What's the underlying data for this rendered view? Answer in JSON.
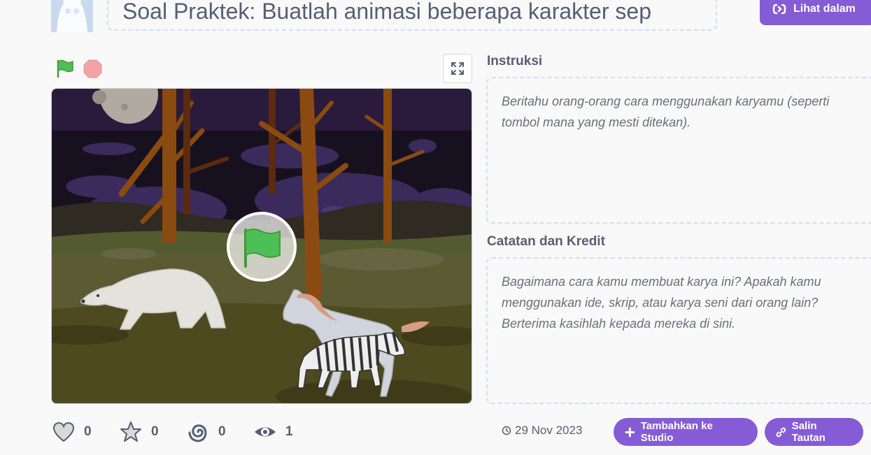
{
  "header": {
    "project_title": "Soal Praktek: Buatlah animasi beberapa karakter sep",
    "see_inside_label": "Lihat dalam"
  },
  "sidebar": {
    "instructions_label": "Instruksi",
    "instructions_placeholder": "Beritahu orang-orang cara menggunakan karyamu (seperti tombol mana yang mesti ditekan).",
    "notes_label": "Catatan dan Kredit",
    "notes_placeholder": "Bagaimana cara kamu membuat karya ini? Apakah kamu menggunakan ide, skrip, atau karya seni dari orang lain? Berterima kasihlah kepada mereka di sini."
  },
  "stats": {
    "loves": "0",
    "favorites": "0",
    "remixes": "0",
    "views": "1"
  },
  "footer": {
    "date": "29 Nov 2023",
    "add_to_studio_label": "Tambahkan ke Studio",
    "copy_link_label": "Salin Tautan"
  },
  "colors": {
    "accent": "#855cd6",
    "text": "#575e75",
    "flag_green": "#4cbf56",
    "stop_red": "#f2a3a3"
  },
  "icons": [
    "remix-icon",
    "green-flag-icon",
    "stop-icon",
    "fullscreen-icon",
    "heart-icon",
    "star-icon",
    "remix-swirl-icon",
    "eye-icon",
    "clock-icon",
    "plus-icon",
    "link-icon"
  ]
}
